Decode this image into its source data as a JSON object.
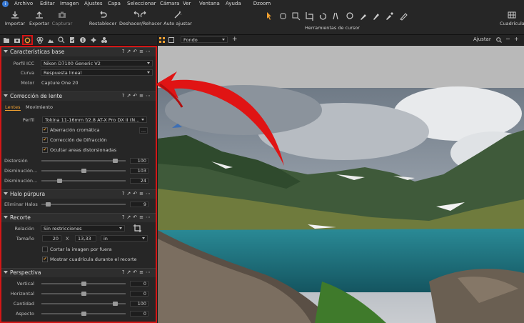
{
  "menu": {
    "items": [
      "Archivo",
      "Editar",
      "Imagen",
      "Ajustes",
      "Capa",
      "Seleccionar",
      "Cámara",
      "Ver",
      "Ventana",
      "Ayuda"
    ],
    "app_title": "Dzoom"
  },
  "toolbar": {
    "importar": "Importar",
    "exportar": "Exportar",
    "capturar": "Capturar",
    "restablecer": "Restablecer",
    "deshacer": "Deshacer/Rehacer",
    "auto": "Auto ajustar",
    "cursor_tools": "Herramientas de cursor",
    "cuadricula": "Cuadrícula"
  },
  "viewer_bar": {
    "background_option": "Fondo",
    "ajustar": "Ajustar"
  },
  "caracteristicas": {
    "title": "Características base",
    "icc_label": "Perfil ICC",
    "icc_value": "Nikon D7100 Generic V2",
    "curva_label": "Curva",
    "curva_value": "Respuesta lineal",
    "motor_label": "Motor",
    "motor_value": "Capture One 20"
  },
  "lente": {
    "title": "Corrección de lente",
    "tab_lentes": "Lentes",
    "tab_movimiento": "Movimiento",
    "perfil_label": "Perfil",
    "perfil_value": "Tokina 11-16mm f/2.8 AT-X Pro DX II (N...",
    "more_btn": "...",
    "chk_aberracion": "Aberración cromática",
    "chk_difraccion": "Corrección de Difracción",
    "chk_ocultar": "Ocultar areas distorsionadas",
    "distorsion_label": "Distorsión",
    "distorsion_value": "100",
    "distorsion_level": 0.9,
    "dis1_label": "Disminución...",
    "dis1_value": "103",
    "dis1_level": 0.5,
    "dis2_label": "Disminución...",
    "dis2_value": "24",
    "dis2_level": 0.2
  },
  "halo": {
    "title": "Halo púrpura",
    "eliminar_label": "Eliminar Halos",
    "eliminar_value": "9",
    "eliminar_level": 0.05
  },
  "recorte": {
    "title": "Recorte",
    "relacion_label": "Relación",
    "relacion_value": "Sin restricciones",
    "tamano_label": "Tamaño",
    "width": "20",
    "x": "X",
    "height": "13,33",
    "unit": "in",
    "chk_cortar": "Cortar la imagen por fuera",
    "chk_mostrar": "Mostrar cuadrícula durante el recorte"
  },
  "perspectiva": {
    "title": "Perspectiva",
    "vertical_label": "Vertical",
    "vertical_value": "0",
    "vertical_level": 0.5,
    "horizontal_label": "Horizontal",
    "horizontal_value": "0",
    "horizontal_level": 0.5,
    "cantidad_label": "Cantidad",
    "cantidad_value": "100",
    "cantidad_level": 0.9,
    "aspecto_label": "Aspecto",
    "aspecto_value": "0",
    "aspecto_level": 0.5
  },
  "colors": {
    "highlight_red": "#d31616",
    "accent_orange": "#f0a030"
  }
}
